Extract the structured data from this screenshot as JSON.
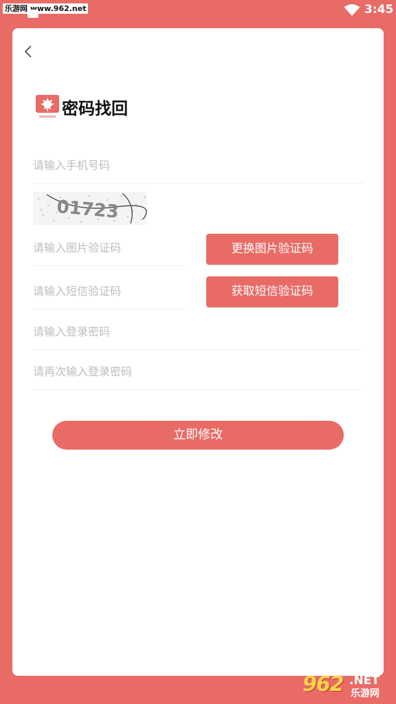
{
  "status_bar": {
    "watermark": "乐游网 www.962.net",
    "time": "3:45",
    "wifi_icon": "wifi-icon"
  },
  "header": {
    "back_icon": "chevron-left-icon",
    "logo_icon": "maple-leaf-logo",
    "title": "密码找回"
  },
  "form": {
    "phone_placeholder": "请输入手机号码",
    "captcha_text": "01723",
    "image_code_placeholder": "请输入图片验证码",
    "refresh_captcha_label": "更换图片验证码",
    "sms_code_placeholder": "请输入短信验证码",
    "get_sms_label": "获取短信验证码",
    "password_placeholder": "请输入登录密码",
    "confirm_password_placeholder": "请再次输入登录密码",
    "submit_label": "立即修改"
  },
  "watermark_footer": {
    "number": "962",
    "net": ".NET",
    "name": "乐游网"
  },
  "colors": {
    "accent": "#e96b66",
    "placeholder": "#bdbdbd",
    "title": "#111111"
  }
}
